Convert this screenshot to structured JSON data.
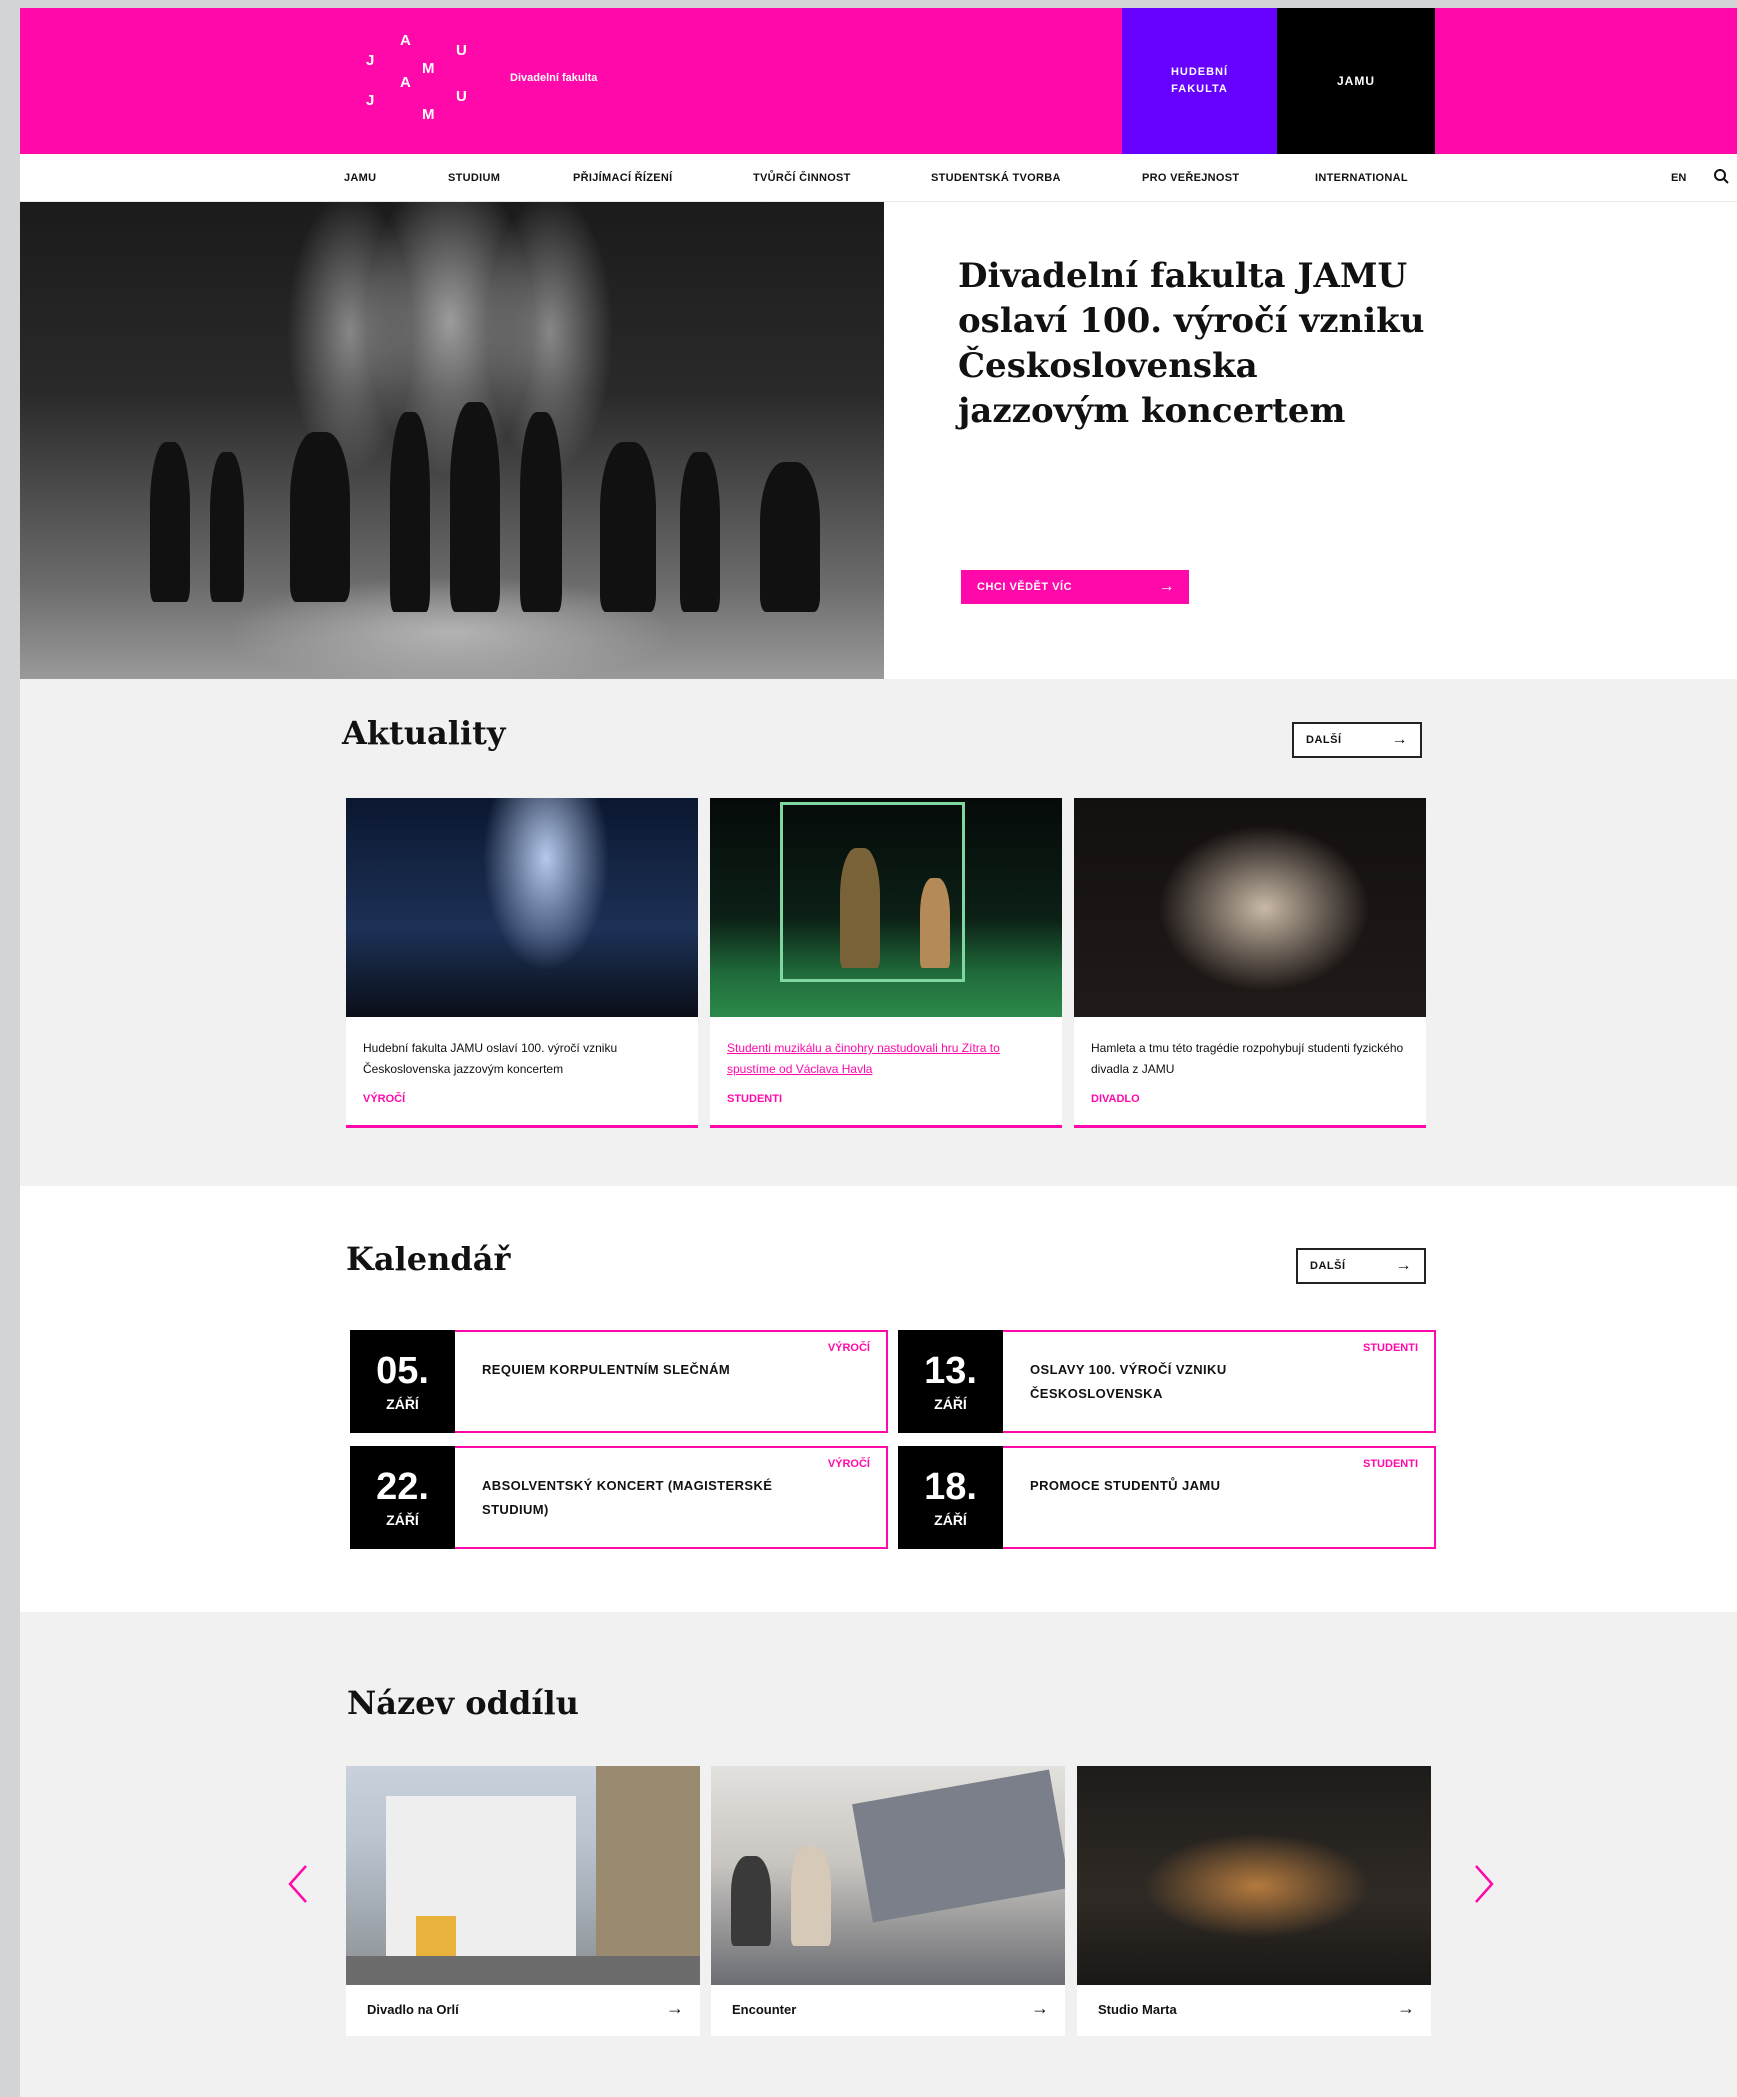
{
  "header": {
    "logo_letters": [
      "J",
      "A",
      "M",
      "U",
      "J",
      "A",
      "M",
      "U"
    ],
    "faculty_name": "Divadelní fakulta",
    "tile_music": "HUDEBNÍ\nFAKULTA",
    "tile_jamu": "JAMU"
  },
  "nav": {
    "items": [
      "JAMU",
      "STUDIUM",
      "PŘIJÍMACÍ ŘÍZENÍ",
      "TVŮRČÍ ČINNOST",
      "STUDENTSKÁ TVORBA",
      "PRO VEŘEJNOST",
      "INTERNATIONAL"
    ],
    "lang": "EN"
  },
  "hero": {
    "title": "Divadelní fakulta JAMU oslaví 100. výročí vzniku Československa jazzovým koncertem",
    "button_label": "CHCI VĚDĚT VÍC",
    "button_arrow": "→"
  },
  "news": {
    "title": "Aktuality",
    "more_label": "DALŠÍ",
    "more_arrow": "→",
    "items": [
      {
        "text": "Hudební fakulta JAMU oslaví 100. výročí vzniku Československa jazzovým koncertem",
        "tag": "VÝROČÍ"
      },
      {
        "text": "Studenti muzikálu a činohry nastudovali hru Zítra to spustíme od Václava Havla",
        "tag": "STUDENTI"
      },
      {
        "text": "Hamleta a tmu této tragédie rozpohybují studenti fyzického divadla z JAMU",
        "tag": "DIVADLO"
      }
    ]
  },
  "calendar": {
    "title": "Kalendář",
    "more_label": "DALŠÍ",
    "more_arrow": "→",
    "events": [
      {
        "day": "05.",
        "month": "ZÁŘÍ",
        "title": "REQUIEM KORPULENTNÍM SLEČNÁM",
        "tag": "VÝROČÍ"
      },
      {
        "day": "13.",
        "month": "ZÁŘÍ",
        "title": "OSLAVY 100. VÝROČÍ VZNIKU ČESKOSLOVENSKA",
        "tag": "STUDENTI"
      },
      {
        "day": "22.",
        "month": "ZÁŘÍ",
        "title": "ABSOLVENTSKÝ KONCERT (MAGISTERSKÉ STUDIUM)",
        "tag": "VÝROČÍ"
      },
      {
        "day": "18.",
        "month": "ZÁŘÍ",
        "title": "PROMOCE STUDENTŮ JAMU",
        "tag": "STUDENTI"
      }
    ]
  },
  "section": {
    "title": "Název oddílu",
    "cards": [
      {
        "label": "Divadlo na Orlí",
        "arrow": "→"
      },
      {
        "label": "Encounter",
        "arrow": "→"
      },
      {
        "label": "Studio Marta",
        "arrow": "→"
      }
    ],
    "prev_icon": "chevron-left-icon",
    "next_icon": "chevron-right-icon"
  },
  "colors": {
    "brand_pink": "#ff09aa",
    "music_purple": "#6600ff",
    "jamu_black": "#000000"
  }
}
